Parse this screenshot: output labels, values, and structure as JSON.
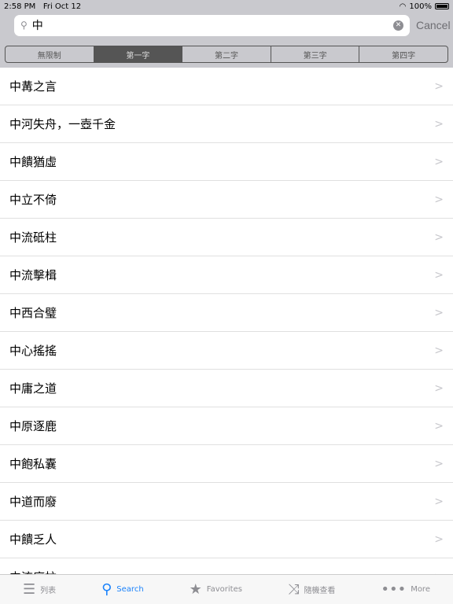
{
  "status": {
    "time": "2:58 PM",
    "date": "Fri Oct 12",
    "battery": "100%"
  },
  "search": {
    "value": "中",
    "cancel": "Cancel"
  },
  "segments": [
    {
      "label": "無限制",
      "selected": false
    },
    {
      "label": "第一字",
      "selected": true
    },
    {
      "label": "第二字",
      "selected": false
    },
    {
      "label": "第三字",
      "selected": false
    },
    {
      "label": "第四字",
      "selected": false
    }
  ],
  "items": [
    "中冓之言",
    "中河失舟，一壺千金",
    "中饋猶虛",
    "中立不倚",
    "中流砥柱",
    "中流擊楫",
    "中西合璧",
    "中心搖搖",
    "中庸之道",
    "中原逐鹿",
    "中飽私囊",
    "中道而廢",
    "中饋乏人",
    "中流底柱"
  ],
  "tabs": [
    {
      "label": "列表",
      "icon": "list-icon"
    },
    {
      "label": "Search",
      "icon": "search-icon",
      "active": true
    },
    {
      "label": "Favorites",
      "icon": "star-icon"
    },
    {
      "label": "隨機查看",
      "icon": "shuffle-icon"
    },
    {
      "label": "More",
      "icon": "more-icon"
    }
  ],
  "colors": {
    "accent": "#1a82fb",
    "selected_segment": "#555555"
  }
}
